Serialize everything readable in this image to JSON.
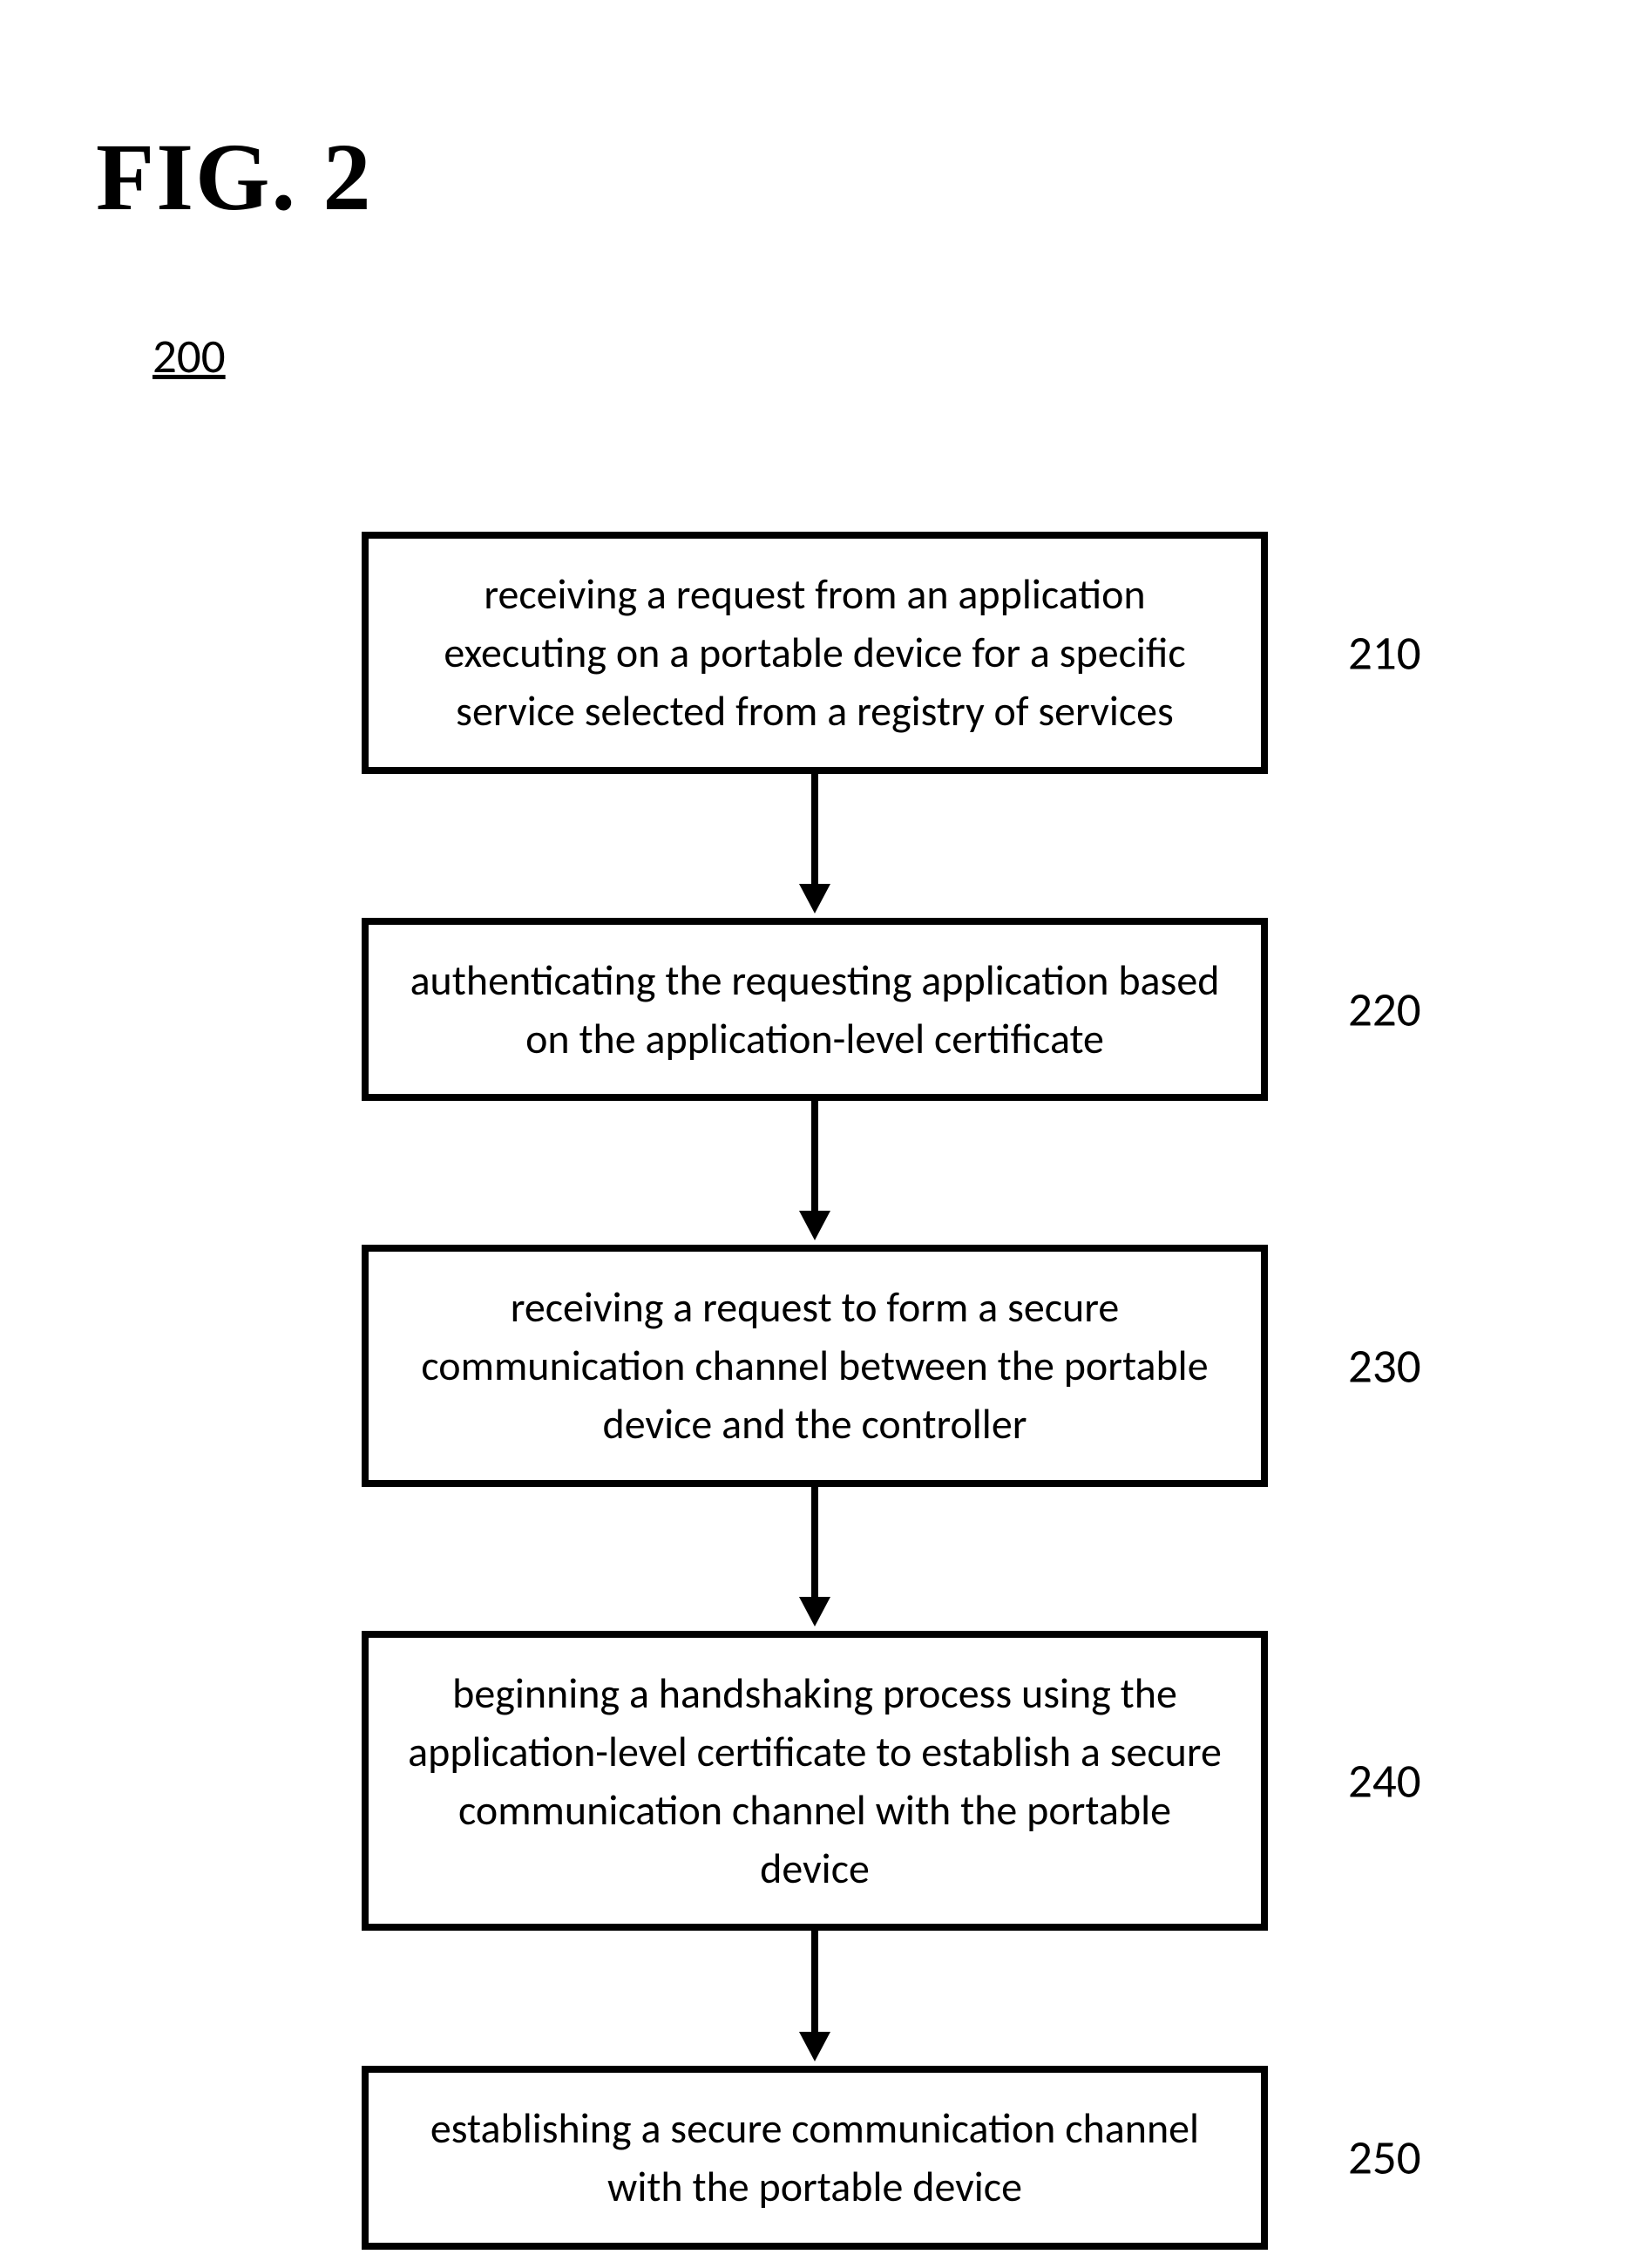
{
  "figure": {
    "title": "FIG. 2",
    "ref": "200"
  },
  "steps": [
    {
      "num": "210",
      "text": "receiving a request from an application executing on a portable device for a specific service selected from a registry of services"
    },
    {
      "num": "220",
      "text": "authenticating the requesting application based on the application-level certificate"
    },
    {
      "num": "230",
      "text": "receiving a request to form a secure communication channel between the portable device and the controller"
    },
    {
      "num": "240",
      "text": "beginning a handshaking process using the application-level certificate to establish a secure communication channel with the portable device"
    },
    {
      "num": "250",
      "text": "establishing a secure communication channel with the portable device"
    }
  ]
}
